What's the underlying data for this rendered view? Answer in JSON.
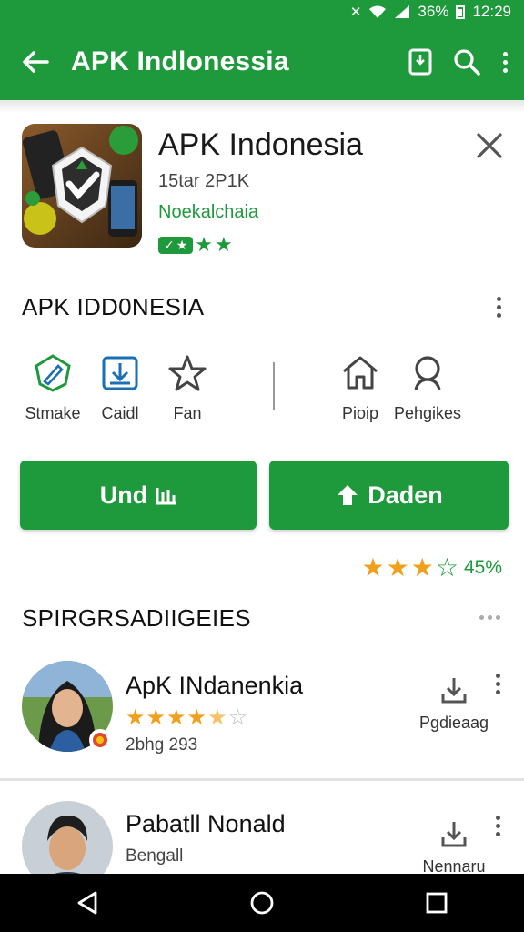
{
  "status_bar": {
    "battery": "36%",
    "time": "12:29"
  },
  "app_bar": {
    "title": "APK Indlonessia"
  },
  "app": {
    "name": "APK Indonesia",
    "subtitle": "15tar 2P1K",
    "developer": "Noekalchaia",
    "badge_rating": 3
  },
  "section": {
    "title": "APK IDD0NESIA"
  },
  "icon_items": [
    {
      "name": "shield-pen-icon",
      "label": "Stmake"
    },
    {
      "name": "download-tray-icon",
      "label": "Caidl"
    },
    {
      "name": "star-outline-icon",
      "label": "Fan"
    },
    {
      "name": "home-outline-icon",
      "label": "Pioip"
    },
    {
      "name": "person-outline-icon",
      "label": "Pehgikes"
    }
  ],
  "buttons": {
    "primary_label": "Und",
    "secondary_label": "Daden"
  },
  "rating": {
    "stars_filled": 3,
    "stars_total": 4,
    "percent_label": "45%"
  },
  "list_section": {
    "title": "SPIRGRSADIIGEIES"
  },
  "list": [
    {
      "name": "ApK INdanenkia",
      "stars_filled": 4.5,
      "stars_total": 5,
      "sub": "2bhg 293",
      "action_label": "Pgdieaag"
    },
    {
      "name": "Pabatll Nonald",
      "sub": "Bengall",
      "action_label": "Nennaru"
    }
  ],
  "colors": {
    "brand_green": "#1e9a3c",
    "star_orange": "#f0a01c"
  }
}
